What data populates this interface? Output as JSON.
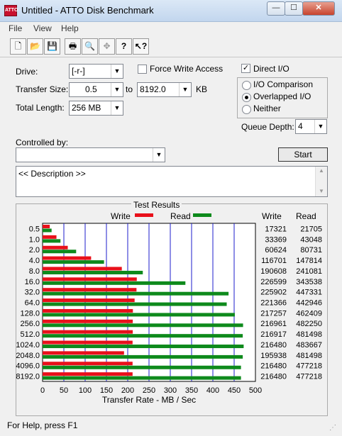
{
  "window": {
    "title": "Untitled - ATTO Disk Benchmark",
    "app_icon": "ATTO"
  },
  "menu": [
    "File",
    "View",
    "Help"
  ],
  "toolbar_icons": [
    "new-icon",
    "open-icon",
    "save-icon",
    "print-icon",
    "print-preview-icon",
    "move-icon",
    "help-icon",
    "context-help-icon"
  ],
  "form": {
    "drive_label": "Drive:",
    "drive_value": "[-r-]",
    "force_write_label": "Force Write Access",
    "force_write_checked": false,
    "direct_io_label": "Direct I/O",
    "direct_io_checked": true,
    "transfer_size_label": "Transfer Size:",
    "transfer_from": "0.5",
    "to_label": "to",
    "transfer_to": "8192.0",
    "unit": "KB",
    "total_length_label": "Total Length:",
    "total_length_value": "256 MB",
    "mode_options": [
      "I/O Comparison",
      "Overlapped I/O",
      "Neither"
    ],
    "mode_selected": 1,
    "queue_depth_label": "Queue Depth:",
    "queue_depth_value": "4",
    "controlled_by_label": "Controlled by:",
    "controlled_by_value": "",
    "start_label": "Start",
    "description": "<< Description >>"
  },
  "results": {
    "title": "Test Results",
    "legend_write": "Write",
    "legend_read": "Read",
    "col_write": "Write",
    "col_read": "Read",
    "colors": {
      "write": "#e8101a",
      "read": "#0e8a1c",
      "grid": "#1c1ccc"
    }
  },
  "status": "For Help, press F1",
  "chart_data": {
    "type": "bar",
    "categories": [
      "0.5",
      "1.0",
      "2.0",
      "4.0",
      "8.0",
      "16.0",
      "32.0",
      "64.0",
      "128.0",
      "256.0",
      "512.0",
      "1024.0",
      "2048.0",
      "4096.0",
      "8192.0"
    ],
    "series": [
      {
        "name": "Write",
        "values": [
          17321,
          33369,
          60624,
          116701,
          190608,
          226599,
          225902,
          221366,
          217257,
          216961,
          216917,
          216480,
          195938,
          216480,
          216480
        ]
      },
      {
        "name": "Read",
        "values": [
          21705,
          43048,
          80731,
          147814,
          241081,
          343538,
          447331,
          442946,
          462409,
          482250,
          481498,
          483667,
          481498,
          477218,
          477218
        ]
      }
    ],
    "xlabel": "Transfer Rate - MB / Sec",
    "xticks": [
      0,
      50,
      100,
      150,
      200,
      250,
      300,
      350,
      400,
      450,
      500
    ],
    "xlim": [
      0,
      500
    ],
    "orientation": "horizontal",
    "grid": true
  }
}
